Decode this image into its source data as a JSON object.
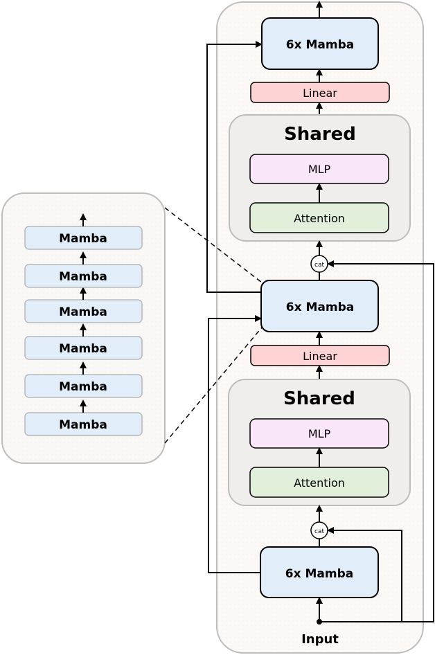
{
  "diagram": {
    "colors": {
      "mamba_fill": "#e1edf9",
      "linear_fill": "#fdd3d3",
      "mlp_fill": "#f9e6f8",
      "attention_fill": "#e2efdb",
      "shared_fill": "#f0eeec",
      "outer_panel_fill": "#fcf8f5",
      "outer_panel_stroke": "#bdbdbd",
      "line": "#000000"
    },
    "main_stack": {
      "mamba_top": "6x Mamba",
      "linear_top": "Linear",
      "shared_top": {
        "title": "Shared",
        "mlp": "MLP",
        "attention": "Attention"
      },
      "cat_top": "cat",
      "mamba_mid": "6x Mamba",
      "linear_mid": "Linear",
      "shared_bottom": {
        "title": "Shared",
        "mlp": "MLP",
        "attention": "Attention"
      },
      "cat_bottom": "cat",
      "mamba_bottom": "6x Mamba",
      "input_label": "Input"
    },
    "expanded_stack": {
      "layers": [
        "Mamba",
        "Mamba",
        "Mamba",
        "Mamba",
        "Mamba",
        "Mamba"
      ]
    }
  }
}
